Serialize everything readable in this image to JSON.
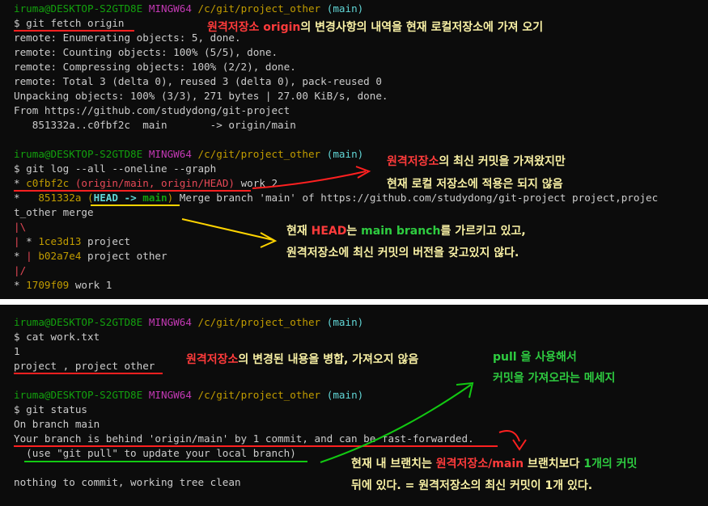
{
  "colors": {
    "red": "#ff2020",
    "yellow": "#ffd400",
    "green": "#12c912",
    "blue": "#3b78ff",
    "prompt_green": "#13a10e",
    "prompt_magenta": "#c239b3",
    "prompt_yellow": "#c19c00"
  },
  "prompt": {
    "user": "iruma@DESKTOP-S2GTD8E",
    "shell": "MINGW64",
    "path": "/c/git/project_other",
    "branch": "(main)"
  },
  "top": {
    "cmd_fetch": "$ git fetch origin",
    "fetch_out": [
      "remote: Enumerating objects: 5, done.",
      "remote: Counting objects: 100% (5/5), done.",
      "remote: Compressing objects: 100% (2/2), done.",
      "remote: Total 3 (delta 0), reused 3 (delta 0), pack-reused 0",
      "Unpacking objects: 100% (3/3), 271 bytes | 27.00 KiB/s, done.",
      "From https://github.com/studydong/git-project",
      "   851332a..c0fbf2c  main       -> origin/main"
    ],
    "cmd_log": "$ git log --all --oneline --graph",
    "log": {
      "l1_star": "* ",
      "l1_hash": "c0fbf2c",
      "l1_refs": "(origin/main, origin/HEAD)",
      "l1_msg": " work 2",
      "l2_star": "*   ",
      "l2_hash": "851332a",
      "l2_open": "(",
      "l2_head": "HEAD -> ",
      "l2_main": "main",
      "l2_close": ")",
      "l2_msg": " Merge branch 'main' of https://github.com/studydong/git-project project,projec",
      "l2_wrap": "t_other merge",
      "l3": "|\\",
      "l4_pipe": "| ",
      "l4_star": "* ",
      "l4_hash": "1ce3d13",
      "l4_msg": " project",
      "l5_star": "* ",
      "l5_pipe": "| ",
      "l5_hash": "b02a7e4",
      "l5_msg": " project other",
      "l6": "|/",
      "l7_star": "* ",
      "l7_hash": "1709f09",
      "l7_msg": " work 1"
    }
  },
  "bottom": {
    "cmd_cat": "$ cat work.txt",
    "cat_out": [
      "1",
      "project , project other"
    ],
    "cmd_status": "$ git status",
    "status_out": [
      "On branch main",
      "Your branch is behind 'origin/main' by 1 commit, and can be fast-forwarded.",
      "  (use \"git pull\" to update your local branch)",
      "",
      "nothing to commit, working tree clean"
    ]
  },
  "annotations": {
    "a1": {
      "p1": "원격저장소 origin",
      "p2": "의 변경사항의 내역을 현재 로컬저장소에 가져 오기"
    },
    "a2": {
      "line1_p1": "원격저장소",
      "line1_p2": "의 최신 커밋을 가져왔지만",
      "line2": "현재 로컬 저장소에 적용은 되지 않음"
    },
    "a3": {
      "line1_p1": "현재 ",
      "line1_p2": "HEAD",
      "line1_p3": "는 ",
      "line1_p4": "main branch",
      "line1_p5": "를 가르키고 있고,",
      "line2": "원격저장소에 최신 커밋의 버전을 갖고있지 않다."
    },
    "a4": {
      "p1": "원격저장소",
      "p2": "의 변경된 내용을 병합, 가져오지 않음"
    },
    "a5": {
      "line1_p1": "pull",
      "line1_p2": " 을 사용해서",
      "line2": "커밋을 가져오라는 메세지"
    },
    "a6": {
      "line1_p1": "현재 내 브랜치는 ",
      "line1_p2": "원격저장소/main",
      "line1_p3": " 브랜치보다 ",
      "line1_p4": "1개의 커밋",
      "line2": "뒤에 있다. = 원격저장소의 최신 커밋이 1개 있다."
    }
  }
}
